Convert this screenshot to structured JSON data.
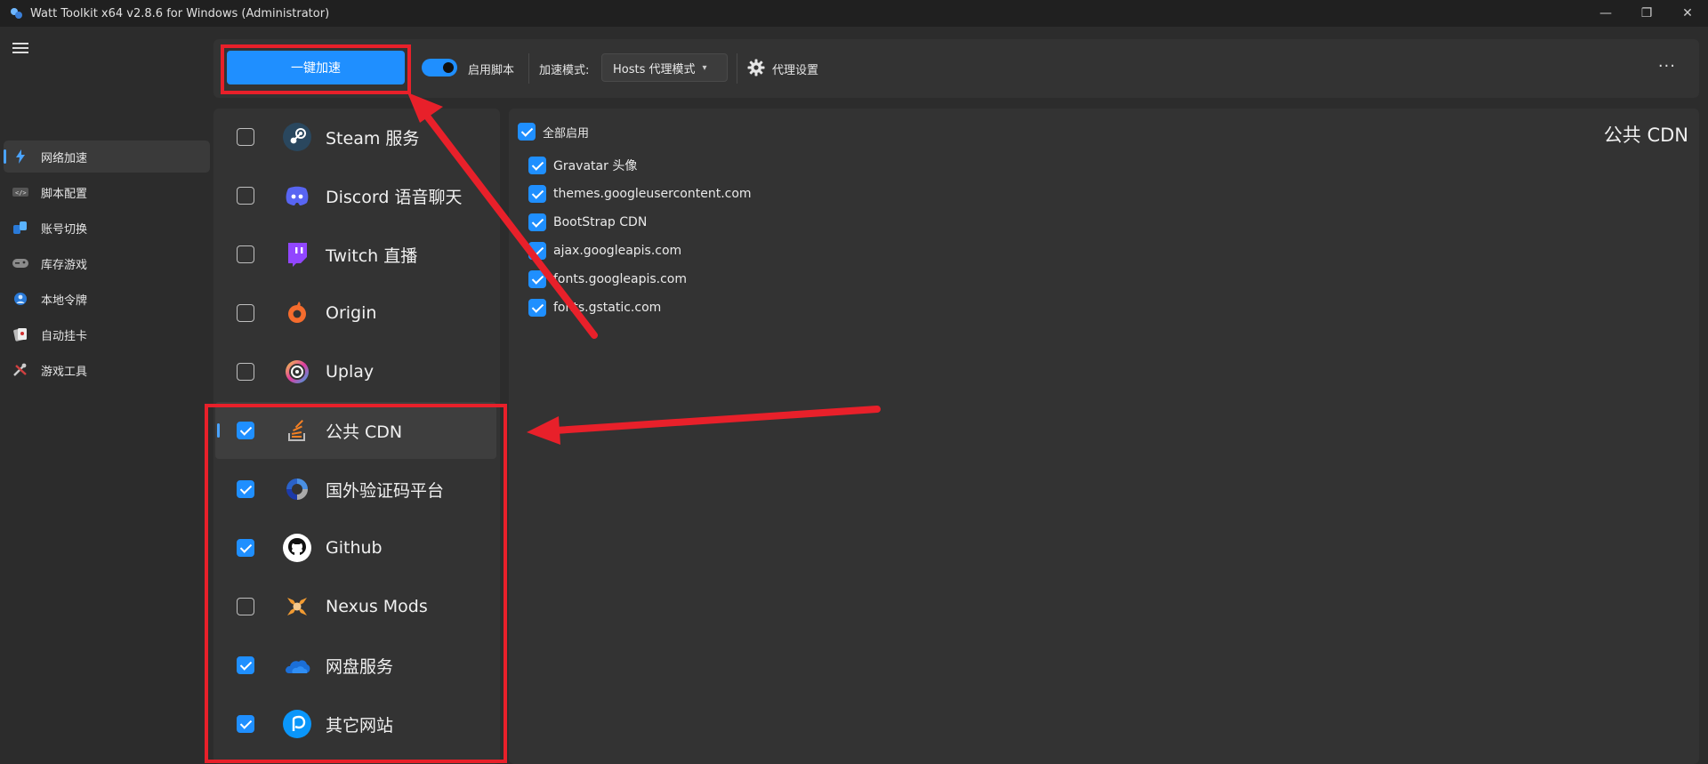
{
  "window": {
    "title": "Watt Toolkit x64 v2.8.6 for Windows (Administrator)",
    "controls": {
      "minimize": "—",
      "restore": "❐",
      "close": "✕"
    }
  },
  "sidebar": {
    "items": [
      {
        "label": "网络加速",
        "icon": "lightning-icon",
        "active": true
      },
      {
        "label": "脚本配置",
        "icon": "script-icon",
        "active": false
      },
      {
        "label": "账号切换",
        "icon": "account-switch-icon",
        "active": false
      },
      {
        "label": "库存游戏",
        "icon": "gamepad-icon",
        "active": false
      },
      {
        "label": "本地令牌",
        "icon": "token-icon",
        "active": false
      },
      {
        "label": "自动挂卡",
        "icon": "cards-icon",
        "active": false
      },
      {
        "label": "游戏工具",
        "icon": "tools-icon",
        "active": false
      }
    ]
  },
  "toolbar": {
    "accelerate_label": "一键加速",
    "script_toggle_label": "启用脚本",
    "script_toggle_on": true,
    "mode_label": "加速模式:",
    "mode_value": "Hosts 代理模式",
    "proxy_settings_label": "代理设置",
    "more_label": "···"
  },
  "services": [
    {
      "name": "Steam 服务",
      "checked": false,
      "icon": "steam-icon"
    },
    {
      "name": "Discord 语音聊天",
      "checked": false,
      "icon": "discord-icon"
    },
    {
      "name": "Twitch 直播",
      "checked": false,
      "icon": "twitch-icon"
    },
    {
      "name": "Origin",
      "checked": false,
      "icon": "origin-icon"
    },
    {
      "name": "Uplay",
      "checked": false,
      "icon": "uplay-icon"
    },
    {
      "name": "公共 CDN",
      "checked": true,
      "icon": "cdn-icon",
      "selected": true
    },
    {
      "name": "国外验证码平台",
      "checked": true,
      "icon": "recaptcha-icon"
    },
    {
      "name": "Github",
      "checked": true,
      "icon": "github-icon"
    },
    {
      "name": "Nexus Mods",
      "checked": false,
      "icon": "nexus-icon"
    },
    {
      "name": "网盘服务",
      "checked": true,
      "icon": "cloud-drive-icon"
    },
    {
      "name": "其它网站",
      "checked": true,
      "icon": "pixiv-icon"
    }
  ],
  "detail": {
    "title": "公共 CDN",
    "enable_all_label": "全部启用",
    "enable_all_checked": true,
    "items": [
      {
        "label": "Gravatar 头像",
        "checked": true
      },
      {
        "label": "themes.googleusercontent.com",
        "checked": true
      },
      {
        "label": "BootStrap CDN",
        "checked": true
      },
      {
        "label": "ajax.googleapis.com",
        "checked": true
      },
      {
        "label": "fonts.googleapis.com",
        "checked": true
      },
      {
        "label": "fonts.gstatic.com",
        "checked": true
      }
    ]
  },
  "colors": {
    "accent": "#1f8fff",
    "annotation": "#e8202a",
    "background": "#2c2c2c",
    "panel": "#333333"
  }
}
